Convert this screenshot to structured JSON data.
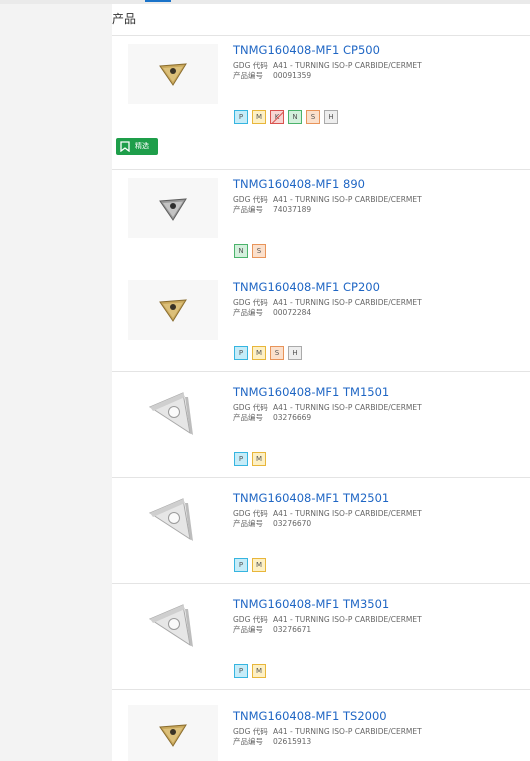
{
  "section_title": "产品",
  "filter_button": {
    "label": "精选",
    "icon": "bookmark-icon"
  },
  "meta_labels": {
    "gdg": "GDG 代码",
    "product_no": "产品编号"
  },
  "tag_colors": {
    "P": "#36b5e0",
    "M": "#e8b63a",
    "K": "#d9534f",
    "N": "#4bb36b",
    "S": "#e8945a",
    "H": "#aaaaaa"
  },
  "products": [
    {
      "name": "TNMG160408-MF1 CP500",
      "gdg": "A41 - TURNING ISO-P CARBIDE/CERMET",
      "product_no": "00091359",
      "tags": [
        "P",
        "M",
        "K",
        "N",
        "S",
        "H"
      ],
      "image": "gold-insert"
    },
    {
      "name": "TNMG160408-MF1 890",
      "gdg": "A41 - TURNING ISO-P CARBIDE/CERMET",
      "product_no": "74037189",
      "tags": [
        "N",
        "S"
      ],
      "image": "grey-insert"
    },
    {
      "name": "TNMG160408-MF1 CP200",
      "gdg": "A41 - TURNING ISO-P CARBIDE/CERMET",
      "product_no": "00072284",
      "tags": [
        "P",
        "M",
        "S",
        "H"
      ],
      "image": "gold-insert"
    },
    {
      "name": "TNMG160408-MF1 TM1501",
      "gdg": "A41 - TURNING ISO-P CARBIDE/CERMET",
      "product_no": "03276669",
      "tags": [
        "P",
        "M"
      ],
      "image": "silver-insert"
    },
    {
      "name": "TNMG160408-MF1 TM2501",
      "gdg": "A41 - TURNING ISO-P CARBIDE/CERMET",
      "product_no": "03276670",
      "tags": [
        "P",
        "M"
      ],
      "image": "silver-insert"
    },
    {
      "name": "TNMG160408-MF1 TM3501",
      "gdg": "A41 - TURNING ISO-P CARBIDE/CERMET",
      "product_no": "03276671",
      "tags": [
        "P",
        "M"
      ],
      "image": "silver-insert"
    },
    {
      "name": "TNMG160408-MF1 TS2000",
      "gdg": "A41 - TURNING ISO-P CARBIDE/CERMET",
      "product_no": "02615913",
      "tags": [],
      "image": "gold-insert"
    }
  ]
}
